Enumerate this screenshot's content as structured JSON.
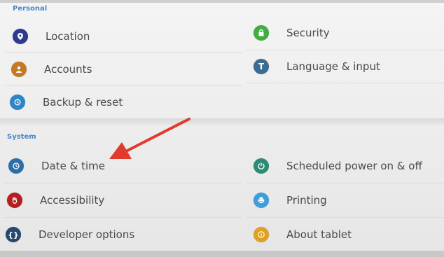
{
  "personal": {
    "title": "Personal",
    "items": [
      {
        "label": "Location",
        "icon": "location-pin-icon",
        "color": "#2f3a8f"
      },
      {
        "label": "Security",
        "icon": "lock-icon",
        "color": "#3fae3f"
      },
      {
        "label": "Accounts",
        "icon": "person-icon",
        "color": "#c37a22"
      },
      {
        "label": "Language & input",
        "icon": "letter-t-icon",
        "color": "#3b6c92"
      },
      {
        "label": "Backup & reset",
        "icon": "backup-icon",
        "color": "#2d86c6"
      }
    ]
  },
  "system": {
    "title": "System",
    "items": [
      {
        "label": "Date & time",
        "icon": "clock-icon",
        "color": "#2b6fa8"
      },
      {
        "label": "Scheduled power on & off",
        "icon": "power-schedule-icon",
        "color": "#2e8a75"
      },
      {
        "label": "Accessibility",
        "icon": "hand-icon",
        "color": "#b51f1f"
      },
      {
        "label": "Printing",
        "icon": "printer-icon",
        "color": "#3ba0d9"
      },
      {
        "label": "Developer options",
        "icon": "braces-icon",
        "color": "#25486e"
      },
      {
        "label": "About tablet",
        "icon": "info-icon",
        "color": "#e0a022"
      }
    ]
  },
  "annotation": {
    "color": "#e23a2d"
  }
}
